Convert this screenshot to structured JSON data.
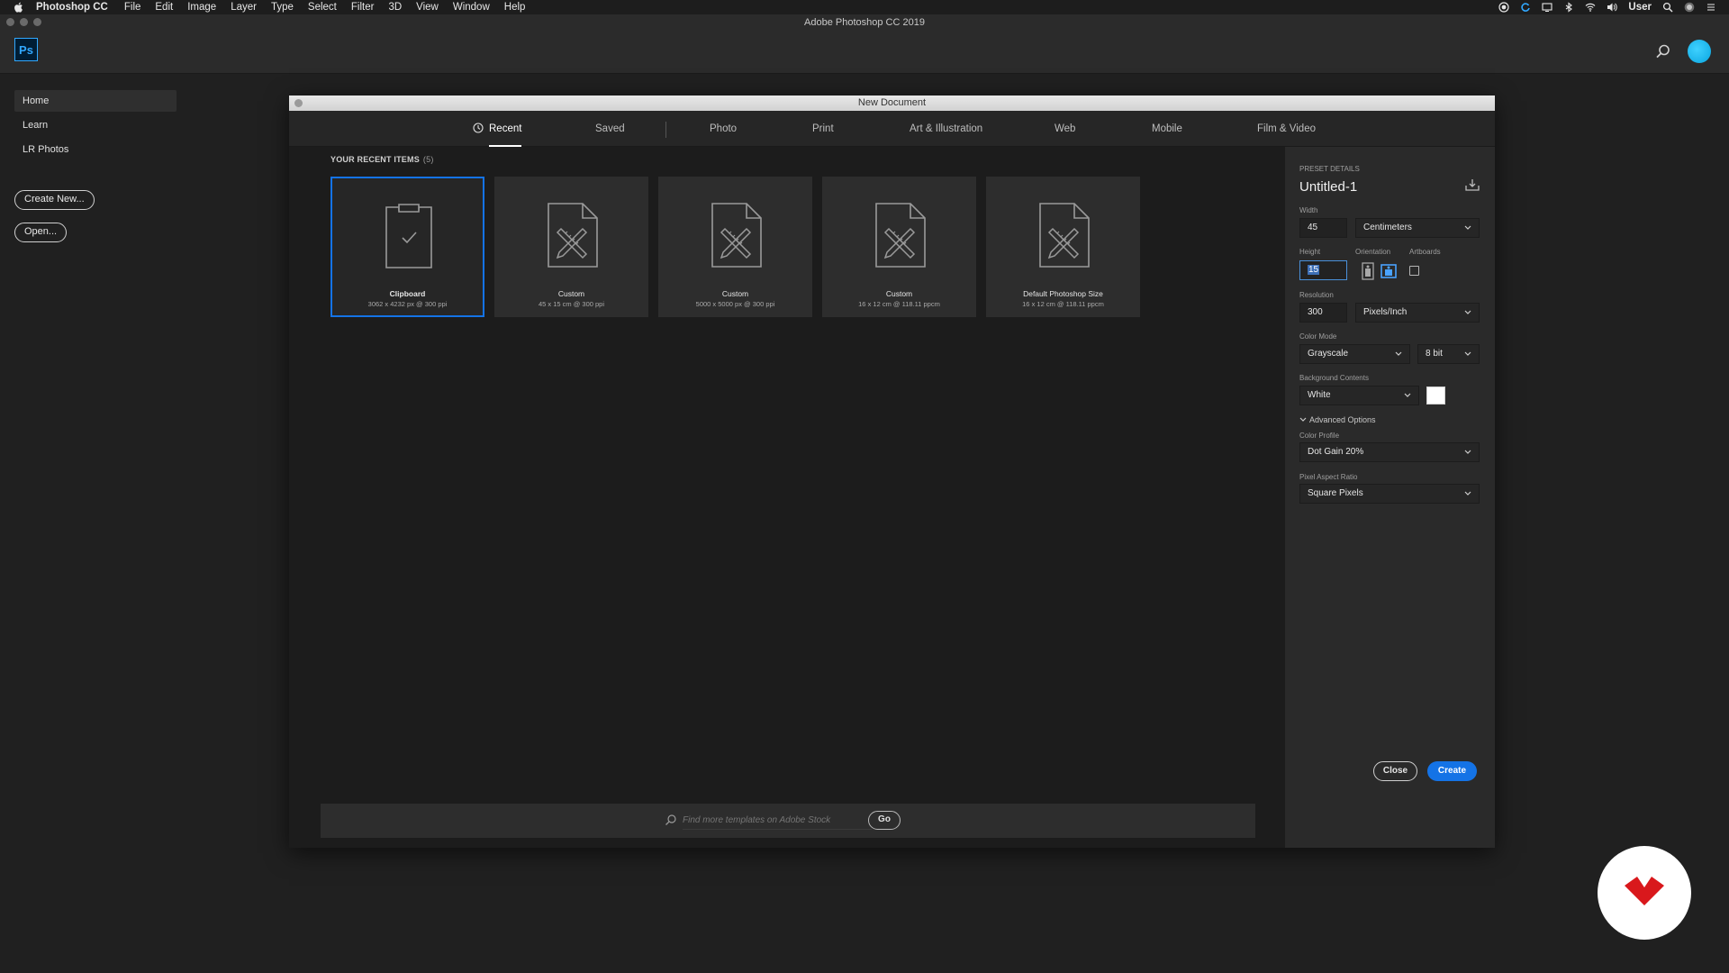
{
  "menubar": {
    "app_name": "Photoshop CC",
    "items": [
      "File",
      "Edit",
      "Image",
      "Layer",
      "Type",
      "Select",
      "Filter",
      "3D",
      "View",
      "Window",
      "Help"
    ],
    "user": "User"
  },
  "window": {
    "title": "Adobe Photoshop CC 2019"
  },
  "appbar": {
    "logo": "Ps"
  },
  "sidebar": {
    "items": [
      {
        "label": "Home",
        "active": true
      },
      {
        "label": "Learn"
      },
      {
        "label": "LR Photos"
      }
    ],
    "create_new": "Create New...",
    "open": "Open..."
  },
  "dialog": {
    "title": "New Document",
    "tabs": [
      "Recent",
      "Saved",
      "Photo",
      "Print",
      "Art & Illustration",
      "Web",
      "Mobile",
      "Film & Video"
    ],
    "active_tab": "Recent",
    "recent_heading": "YOUR RECENT ITEMS",
    "recent_count": "(5)",
    "recent_items": [
      {
        "name": "Clipboard",
        "details": "3062 x 4232 px @ 300 ppi",
        "icon": "clipboard-icon",
        "selected": true
      },
      {
        "name": "Custom",
        "details": "45 x 15 cm @ 300 ppi",
        "icon": "custom-doc-icon"
      },
      {
        "name": "Custom",
        "details": "5000 x 5000 px @ 300 ppi",
        "icon": "custom-doc-icon"
      },
      {
        "name": "Custom",
        "details": "16 x 12 cm @ 118.11 ppcm",
        "icon": "custom-doc-icon"
      },
      {
        "name": "Default Photoshop Size",
        "details": "16 x 12 cm @ 118.11 ppcm",
        "icon": "custom-doc-icon"
      }
    ],
    "stock_search": {
      "placeholder": "Find more templates on Adobe Stock",
      "go": "Go"
    },
    "preset": {
      "heading": "PRESET DETAILS",
      "name": "Untitled-1",
      "width_label": "Width",
      "width": "45",
      "width_unit": "Centimeters",
      "height_label": "Height",
      "height": "15",
      "orientation_label": "Orientation",
      "artboards_label": "Artboards",
      "resolution_label": "Resolution",
      "resolution": "300",
      "resolution_unit": "Pixels/Inch",
      "color_mode_label": "Color Mode",
      "color_mode": "Grayscale",
      "bit_depth": "8 bit",
      "background_label": "Background Contents",
      "background": "White",
      "advanced_label": "Advanced Options",
      "color_profile_label": "Color Profile",
      "color_profile": "Dot Gain 20%",
      "pixel_aspect_label": "Pixel Aspect Ratio",
      "pixel_aspect": "Square Pixels"
    },
    "close": "Close",
    "create": "Create"
  },
  "colors": {
    "accent": "#1473e6",
    "ps_blue": "#31a8ff",
    "watermark_red": "#d9181c"
  }
}
